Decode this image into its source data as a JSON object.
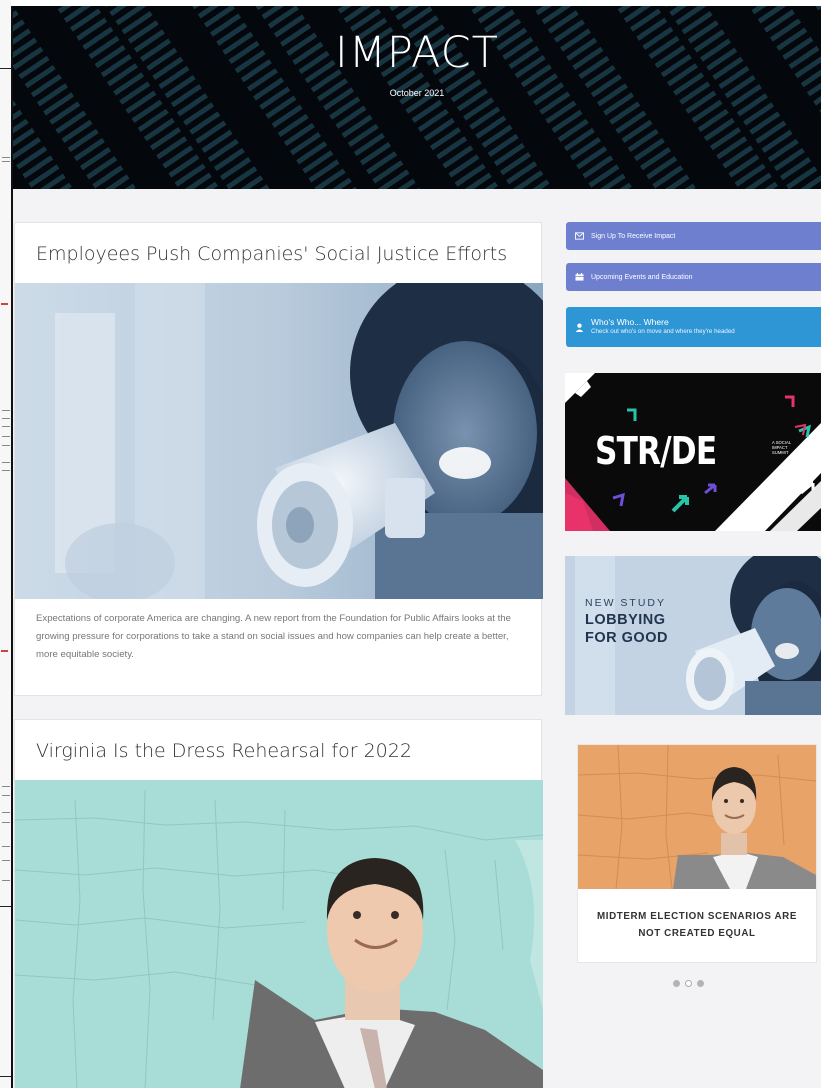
{
  "header": {
    "title": "IMPACT",
    "subtitle": "October 2021"
  },
  "articles": [
    {
      "title": "Employees Push Companies' Social Justice Efforts",
      "image": "woman-with-megaphone-photo",
      "excerpt": "Expectations of corporate America are changing. A new report from the Foundation for Public Affairs looks at the growing pressure for corporations to take a stand on social issues and how companies can help create a better, more equitable society."
    },
    {
      "title": "Virginia Is the Dress Rehearsal for 2022",
      "image": "man-over-us-map-illustration"
    }
  ],
  "sidebar": {
    "buttons": [
      {
        "label": "Sign Up To Receive Impact",
        "icon": "envelope-icon",
        "color": "#6f7fd0"
      },
      {
        "label": "Upcoming Events and Education",
        "icon": "calendar-icon",
        "color": "#6f7fd0"
      }
    ],
    "whos_who": {
      "title": "Who's Who... Where",
      "subtitle": "Check out who's on move and where they're headed",
      "icon": "person-icon",
      "color": "#2f96d6"
    },
    "ad_stride": {
      "word": "STR/DE",
      "tagline": "A SOCIAL IMPACT SUMMIT"
    },
    "ad_study": {
      "line1": "NEW STUDY",
      "line2": "LOBBYING",
      "line3": "FOR GOOD"
    },
    "carousel": {
      "caption": "MIDTERM ELECTION SCENARIOS ARE NOT CREATED EQUAL",
      "slide_count": 3,
      "active_slide": 2
    }
  }
}
